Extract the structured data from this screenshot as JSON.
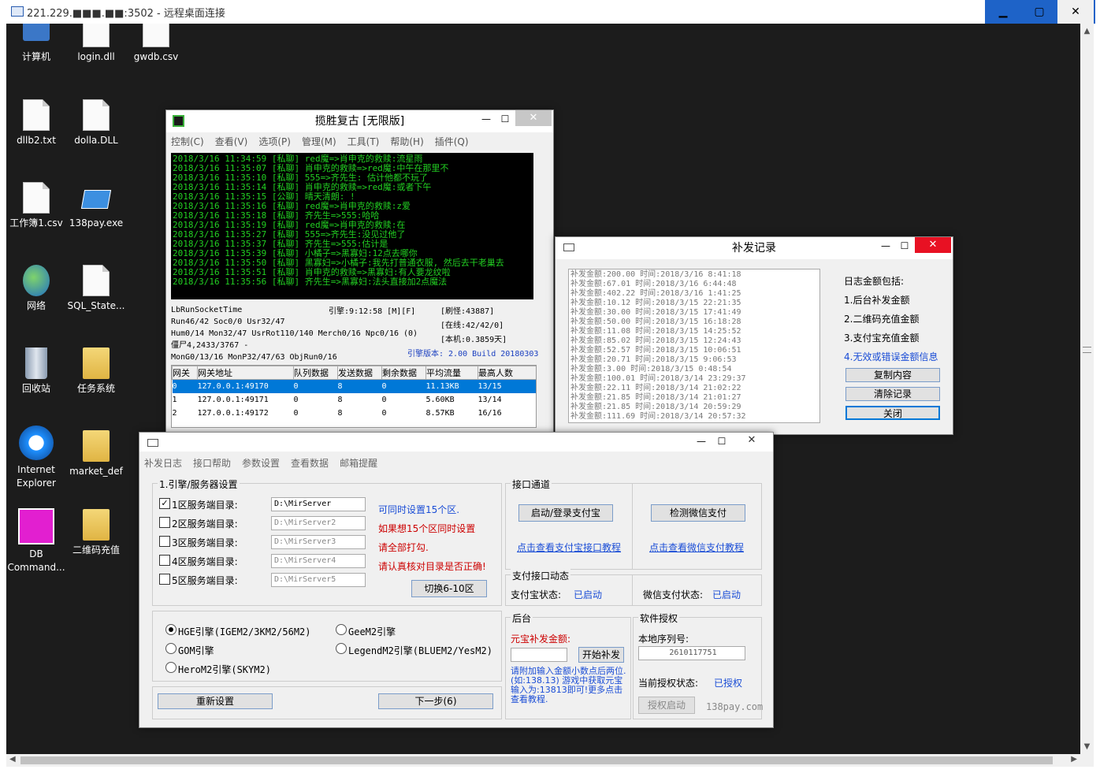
{
  "remote": {
    "title": "221.229.■■■.■■:3502 - 远程桌面连接",
    "min": "▁",
    "max": "▢",
    "close": "✕"
  },
  "desktop": {
    "icons": [
      {
        "label": "计算机"
      },
      {
        "label": "login.dll"
      },
      {
        "label": "gwdb.csv"
      },
      {
        "label": "dllb2.txt"
      },
      {
        "label": "dolla.DLL"
      },
      {
        "label": "工作簿1.csv"
      },
      {
        "label": "138pay.exe"
      },
      {
        "label": "网络"
      },
      {
        "label": "SQL_State..."
      },
      {
        "label": "回收站"
      },
      {
        "label": "任务系统"
      },
      {
        "label": "Internet Explorer"
      },
      {
        "label": "market_def"
      },
      {
        "label": "DB Command..."
      },
      {
        "label": "二维码充值"
      }
    ]
  },
  "game": {
    "title": "揽胜复古 [无限版]",
    "menu": [
      "控制(C)",
      "查看(V)",
      "选项(P)",
      "管理(M)",
      "工具(T)",
      "帮助(H)",
      "插件(Q)"
    ],
    "log": [
      "2018/3/16 11:34:59 [私聊] red魔=>肖申克的救赎:流星雨",
      "2018/3/16 11:35:07 [私聊] 肖申克的救赎=>red魔:中午在那里不",
      "2018/3/16 11:35:10 [私聊] 555=>齐先生:    估计他都不玩了",
      "2018/3/16 11:35:14 [私聊] 肖申克的救赎=>red魔:或者下午",
      "2018/3/16 11:35:15 [公聊] 晴天清朗: !",
      "2018/3/16 11:35:16 [私聊] red魔=>肖申克的救赎:z爱",
      "2018/3/16 11:35:18 [私聊] 齐先生=>555:哈哈",
      "2018/3/16 11:35:19 [私聊] red魔=>肖申克的救赎:在",
      "2018/3/16 11:35:27 [私聊] 555=>齐先生:没见过他了",
      "2018/3/16 11:35:37 [私聊] 齐先生=>555:估计是",
      "2018/3/16 11:35:39 [私聊] 小橘子=>黑寡妇:12点去哪你",
      "2018/3/16 11:35:50 [私聊] 黑寡妇=>小橘子:我先打普通衣服, 然后去干老巢去",
      "2018/3/16 11:35:51 [私聊] 肖申克的救赎=>黑寡妇:有人要龙纹啦",
      "2018/3/16 11:35:56 [私聊] 齐先生=>黑寡妇:法头直接加2点魔法"
    ],
    "stat": {
      "l1": "LbRunSocketTime",
      "l2": "Run46/42 Soc0/0 Usr32/47",
      "l3": "Hum0/14 Mon32/47 UsrRot110/140 Merch0/16 Npc0/16 (0)",
      "l4": "僵尸4,2433/3767 -",
      "l5": "MonG0/13/16 MonP32/47/63 ObjRun0/16",
      "engine_time": "引擎:9:12:58 [M][F]",
      "refresh": "[刷怪:43887]",
      "online": "[在线:42/42/0]",
      "local": "[本机:0.3859天]",
      "version": "引擎版本: 2.00 Build 20180303"
    },
    "table": {
      "headers": [
        "网关",
        "网关地址",
        "队列数据",
        "发送数据",
        "剩余数据",
        "平均流量",
        "最高人数"
      ],
      "rows": [
        [
          "0",
          "127.0.0.1:49170",
          "0",
          "8",
          "0",
          "11.13KB",
          "13/15"
        ],
        [
          "1",
          "127.0.0.1:49171",
          "0",
          "8",
          "0",
          "5.60KB",
          "13/14"
        ],
        [
          "2",
          "127.0.0.1:49172",
          "0",
          "8",
          "0",
          "8.57KB",
          "16/16"
        ]
      ]
    }
  },
  "records": {
    "title": "补发记录",
    "lines": [
      "补发金额:200.00 时间:2018/3/16 8:41:18",
      "补发金额:67.01 时间:2018/3/16 6:44:48",
      "补发金额:402.22 时间:2018/3/16 1:41:25",
      "补发金额:10.12 时间:2018/3/15 22:21:35",
      "补发金额:30.00 时间:2018/3/15 17:41:49",
      "补发金额:50.00 时间:2018/3/15 16:18:28",
      "补发金额:11.08 时间:2018/3/15 14:25:52",
      "补发金额:85.02 时间:2018/3/15 12:24:43",
      "补发金额:52.57 时间:2018/3/15 10:06:51",
      "补发金额:20.71 时间:2018/3/15 9:06:53",
      "补发金额:3.00 时间:2018/3/15 0:48:54",
      "补发金额:100.01 时间:2018/3/14 23:29:37",
      "补发金额:22.11 时间:2018/3/14 21:02:22",
      "补发金额:21.85 时间:2018/3/14 21:01:27",
      "补发金额:21.85 时间:2018/3/14 20:59:29",
      "补发金额:111.69 时间:2018/3/14 20:57:32"
    ],
    "info": [
      "日志金额包括:",
      "1.后台补发金额",
      "2.二维码充值金额",
      "3.支付宝充值金额",
      "4.无效或错误金额信息"
    ],
    "buttons": [
      "复制内容",
      "清除记录",
      "关闭"
    ]
  },
  "pay": {
    "menu": [
      "补发日志",
      "接口帮助",
      "参数设置",
      "查看数据",
      "邮箱提醒"
    ],
    "group_server": "1.引擎/服务器设置",
    "servers": [
      {
        "label": "1区服务端目录:",
        "path": "D:\\MirServer",
        "checked": "✓"
      },
      {
        "label": "2区服务端目录:",
        "path": "D:\\MirServer2",
        "checked": ""
      },
      {
        "label": "3区服务端目录:",
        "path": "D:\\MirServer3",
        "checked": ""
      },
      {
        "label": "4区服务端目录:",
        "path": "D:\\MirServer4",
        "checked": ""
      },
      {
        "label": "5区服务端目录:",
        "path": "D:\\MirServer5",
        "checked": ""
      }
    ],
    "hints": [
      "可同时设置15个区.",
      "如果想15个区同时设置",
      "请全部打勾.",
      "请认真核对目录是否正确!"
    ],
    "switch_btn": "切换6-10区",
    "engines": [
      "HGE引擎(IGEM2/3KM2/56M2)",
      "GeeM2引擎",
      "GOM引擎",
      "LegendM2引擎(BLUEM2/YesM2)",
      "HeroM2引擎(SKYM2)"
    ],
    "reset_btn": "重新设置",
    "next_btn": "下一步(6)",
    "iface": {
      "title": "接口通道",
      "alipay_btn": "启动/登录支付宝",
      "wechat_btn": "检测微信支付",
      "alipay_link": "点击查看支付宝接口教程",
      "wechat_link": "点击查看微信支付教程"
    },
    "status": {
      "title": "支付接口动态",
      "alipay_label": "支付宝状态:",
      "alipay_val": "已启动",
      "wechat_label": "微信支付状态:",
      "wechat_val": "已启动"
    },
    "backend": {
      "title": "后台",
      "amount_label": "元宝补发金额:",
      "start_btn": "开始补发",
      "note": "请附加输入金额小数点后两位.(如:138.13) 游戏中获取元宝输入为:13813即可!更多点击查看教程."
    },
    "license": {
      "title": "软件授权",
      "serial_label": "本地序列号:",
      "serial": "2610117751",
      "state_label": "当前授权状态:",
      "state_val": "已授权",
      "auth_btn": "授权启动",
      "site": "138pay.com"
    }
  }
}
